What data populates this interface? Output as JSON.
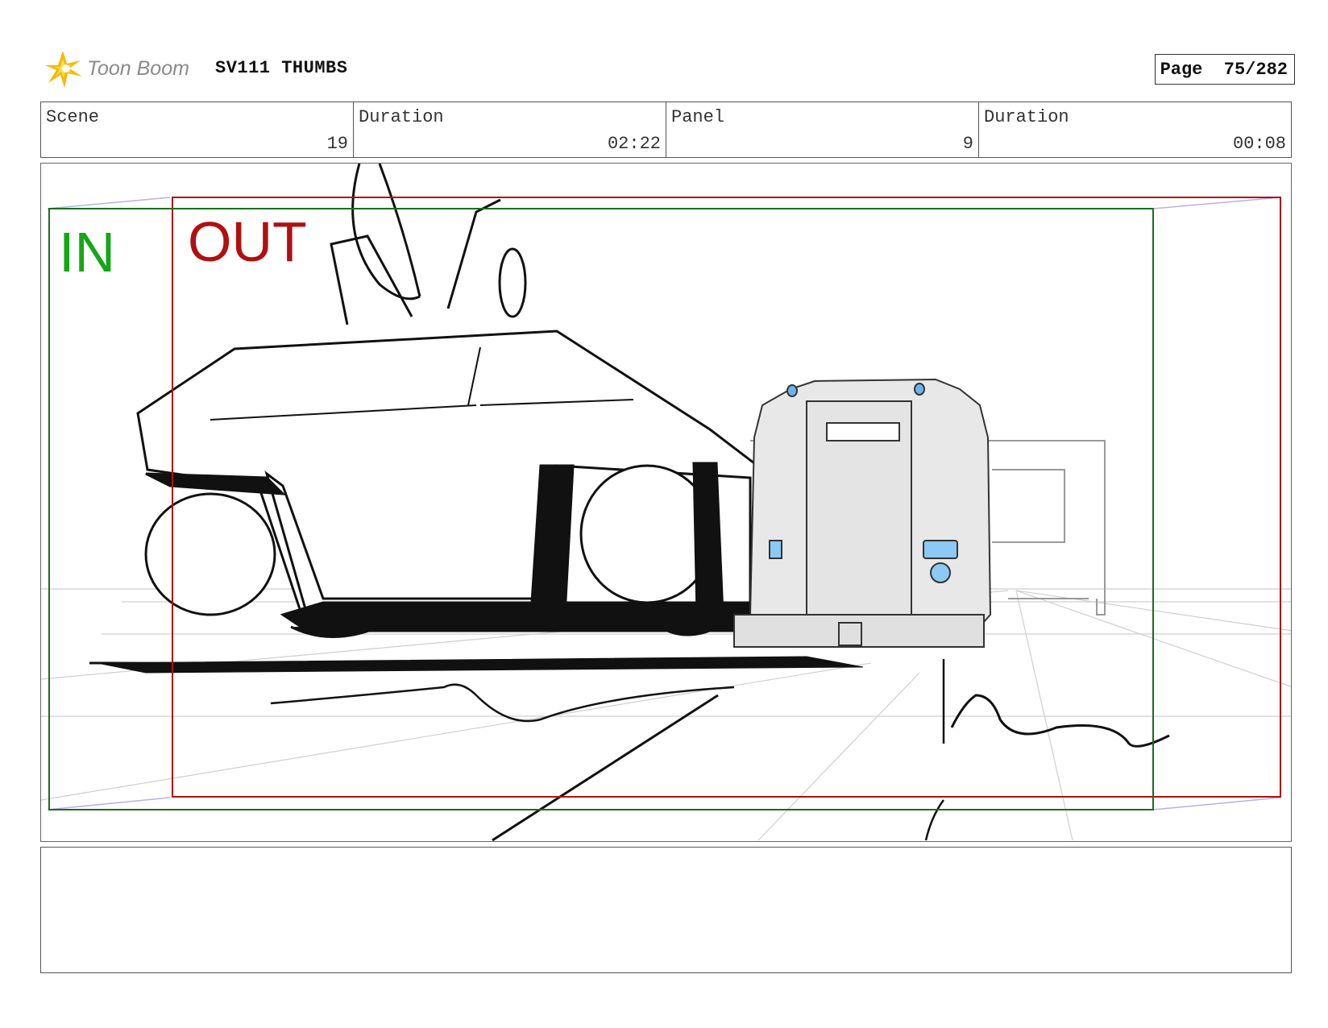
{
  "header": {
    "brand": "Toon Boom",
    "doc_title": "SV111 THUMBS",
    "page_label": "Page",
    "page_value": "75/282"
  },
  "info": [
    {
      "label": "Scene",
      "value": "19"
    },
    {
      "label": "Duration",
      "value": "02:22"
    },
    {
      "label": "Panel",
      "value": "9"
    },
    {
      "label": "Duration",
      "value": "00:08"
    }
  ],
  "panel": {
    "in_label": "IN",
    "out_label": "OUT",
    "in_color": "#16a616",
    "out_color": "#b01010"
  },
  "icons": {
    "logo": "toon-boom-starburst-logo"
  }
}
